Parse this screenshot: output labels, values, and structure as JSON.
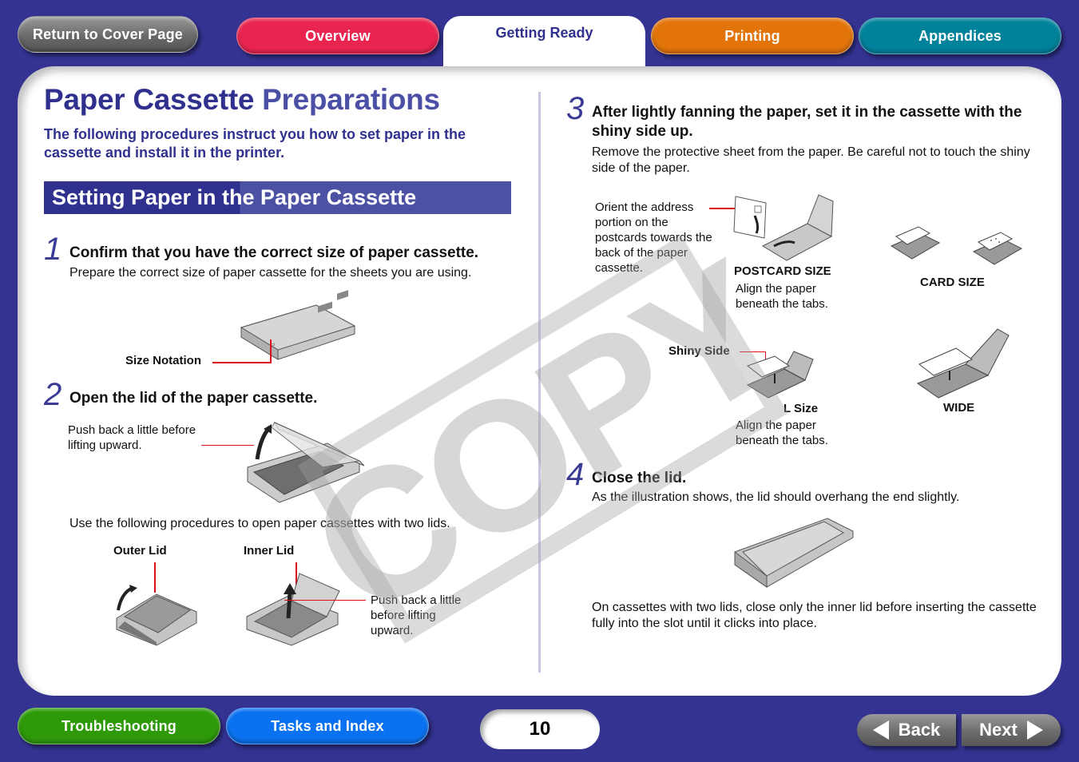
{
  "header": {
    "return_label": "Return to Cover Page",
    "tabs": [
      {
        "label": "Overview",
        "color": "#e9254f"
      },
      {
        "label": "Getting Ready",
        "active": true
      },
      {
        "label": "Printing",
        "color": "#e2740a"
      },
      {
        "label": "Appendices",
        "color": "#00829b"
      }
    ]
  },
  "page": {
    "title_part1": "Paper Cassette",
    "title_part2": "Preparations",
    "intro": "The following procedures instruct you how to set paper in the cassette and install it in the printer.",
    "section_title": "Setting Paper in the Paper Cassette",
    "watermark": "COPY"
  },
  "steps": [
    {
      "number": "1",
      "heading": "Confirm that you have the correct size of paper cassette.",
      "body": "Prepare the correct size of paper cassette for the sheets you are using.",
      "callouts": {
        "size_notation": "Size Notation"
      }
    },
    {
      "number": "2",
      "heading": "Open the lid of the paper cassette.",
      "callouts": {
        "push_back": "Push back a little before lifting upward.",
        "two_lids_intro": "Use the following procedures to open paper cassettes with two lids.",
        "outer_lid": "Outer Lid",
        "inner_lid": "Inner Lid",
        "inner_push_back": "Push back a little before lifting upward."
      }
    },
    {
      "number": "3",
      "heading": "After lightly fanning the paper, set it in the cassette with the shiny side up.",
      "body": "Remove the protective sheet from the paper. Be careful not to touch the shiny side of the paper.",
      "callouts": {
        "orient": "Orient the address portion on the postcards towards the back of the paper cassette.",
        "postcard_size": "POSTCARD SIZE",
        "postcard_align": "Align the paper beneath the tabs.",
        "card_size": "CARD SIZE",
        "shiny_side": "Shiny Side",
        "l_size": "L Size",
        "l_align": "Align the paper beneath the tabs.",
        "wide": "WIDE"
      }
    },
    {
      "number": "4",
      "heading": "Close the lid.",
      "body": "As the illustration shows, the lid should overhang the end slightly.",
      "note": "On cassettes with two lids, close only the inner lid before inserting the cassette fully into the slot until it clicks into place."
    }
  ],
  "footer": {
    "troubleshooting_label": "Troubleshooting",
    "tasks_label": "Tasks and Index",
    "page_number": "10",
    "back_label": "Back",
    "next_label": "Next"
  }
}
